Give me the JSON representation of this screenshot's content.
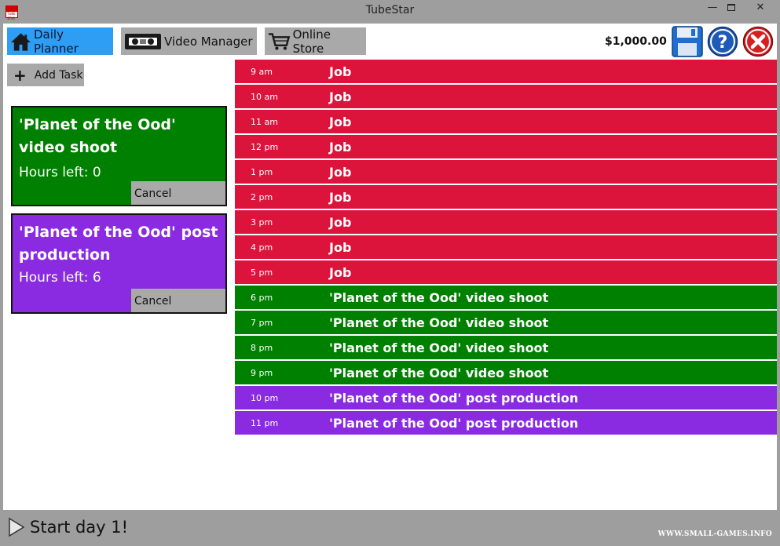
{
  "window": {
    "title": "TubeStar",
    "icon": "tubestar-app-icon",
    "app_icon_text": "TUBE STAR",
    "minimize_label": "—",
    "close_label": "✕"
  },
  "toolbar": {
    "nav": [
      {
        "label": "Daily Planner",
        "icon": "house-icon",
        "active": true
      },
      {
        "label": "Video Manager",
        "icon": "vhs-tape-icon",
        "active": false
      },
      {
        "label": "Online Store",
        "icon": "shopping-cart-icon",
        "active": false
      }
    ],
    "money": "$1,000.00",
    "save_icon": "floppy-disk-icon",
    "help_icon": "help-icon",
    "exit_icon": "exit-icon"
  },
  "add_task": {
    "label": "Add Task",
    "icon": "plus-icon"
  },
  "tasks": [
    {
      "name": "'Planet of the Ood' video shoot",
      "hours": "Hours left: 0",
      "cancel": "Cancel",
      "color": "#008000"
    },
    {
      "name": "'Planet of the Ood' post production",
      "hours": "Hours left: 6",
      "cancel": "Cancel",
      "color": "#8a2be2"
    }
  ],
  "schedule": [
    {
      "time": "9 am",
      "task": "Job",
      "color": "#dc143c"
    },
    {
      "time": "10 am",
      "task": "Job",
      "color": "#dc143c"
    },
    {
      "time": "11 am",
      "task": "Job",
      "color": "#dc143c"
    },
    {
      "time": "12 pm",
      "task": "Job",
      "color": "#dc143c"
    },
    {
      "time": "1 pm",
      "task": "Job",
      "color": "#dc143c"
    },
    {
      "time": "2 pm",
      "task": "Job",
      "color": "#dc143c"
    },
    {
      "time": "3 pm",
      "task": "Job",
      "color": "#dc143c"
    },
    {
      "time": "4 pm",
      "task": "Job",
      "color": "#dc143c"
    },
    {
      "time": "5 pm",
      "task": "Job",
      "color": "#dc143c"
    },
    {
      "time": "6 pm",
      "task": "'Planet of the Ood' video shoot",
      "color": "#008000"
    },
    {
      "time": "7 pm",
      "task": "'Planet of the Ood' video shoot",
      "color": "#008000"
    },
    {
      "time": "8 pm",
      "task": "'Planet of the Ood' video shoot",
      "color": "#008000"
    },
    {
      "time": "9 pm",
      "task": "'Planet of the Ood' video shoot",
      "color": "#008000"
    },
    {
      "time": "10 pm",
      "task": "'Planet of the Ood' post production",
      "color": "#8a2be2"
    },
    {
      "time": "11 pm",
      "task": "'Planet of the Ood' post production",
      "color": "#8a2be2"
    }
  ],
  "footer": {
    "start_label": "Start day 1!",
    "start_icon": "play-icon",
    "watermark": "WWW.SMALL-GAMES.INFO"
  }
}
